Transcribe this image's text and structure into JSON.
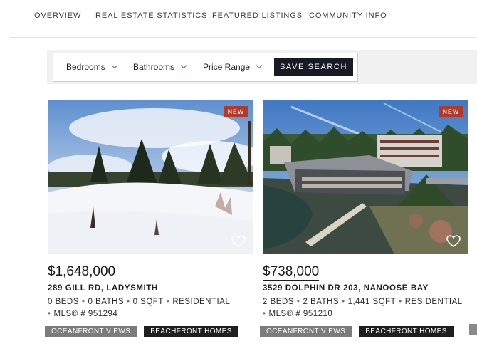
{
  "nav": {
    "items": [
      "OVERVIEW",
      "REAL ESTATE STATISTICS",
      "FEATURED LISTINGS",
      "COMMUNITY INFO"
    ]
  },
  "filters": {
    "bedrooms": "Bedrooms",
    "bathrooms": "Bathrooms",
    "price_range": "Price Range",
    "save_label": "SAVE SEARCH"
  },
  "icons": {
    "dropdown": "chevron-down-icon",
    "favorite": "heart-icon"
  },
  "colors": {
    "accent": "#b23a2a",
    "button_dark": "#1a1a27",
    "tag_grey": "#7c7c7c",
    "tag_dark": "#1f1f1f"
  },
  "listings": [
    {
      "badge": "NEW",
      "price": "$1,648,000",
      "address": "289 GILL RD, LADYSMITH",
      "facts_line1": [
        "0 BEDS",
        "0 BATHS",
        "0 SQFT",
        "RESIDENTIAL"
      ],
      "mls": "MLS® # 951294",
      "tags": [
        "OCEANFRONT VIEWS",
        "BEACHFRONT HOMES"
      ]
    },
    {
      "badge": "NEW",
      "price": "$738,000",
      "address": "3529 DOLPHIN DR 203, NANOOSE BAY",
      "facts_line1": [
        "2 BEDS",
        "2 BATHS",
        "1,441 SQFT",
        "RESIDENTIAL"
      ],
      "mls": "MLS® # 951210",
      "tags": [
        "OCEANFRONT VIEWS",
        "BEACHFRONT HOMES"
      ]
    }
  ]
}
